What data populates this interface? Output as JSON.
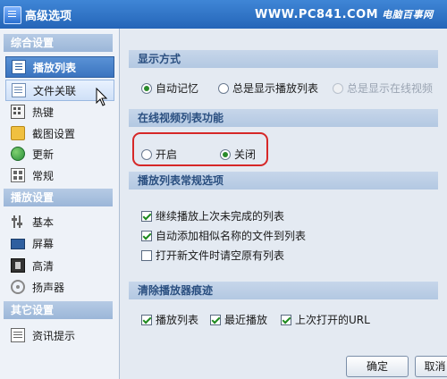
{
  "window": {
    "title": "高级选项",
    "watermark": "WWW.PC841.COM",
    "watermark_brand": "电脑百事网"
  },
  "sidebar": {
    "section1": "综合设置",
    "items1": [
      {
        "label": "播放列表",
        "icon": "list-icon"
      },
      {
        "label": "文件关联",
        "icon": "file-icon"
      },
      {
        "label": "热键",
        "icon": "keyboard-icon"
      },
      {
        "label": "截图设置",
        "icon": "folder-icon"
      },
      {
        "label": "更新",
        "icon": "globe-icon"
      },
      {
        "label": "常规",
        "icon": "grid-icon"
      }
    ],
    "section2": "播放设置",
    "items2": [
      {
        "label": "基本",
        "icon": "sliders-icon"
      },
      {
        "label": "屏幕",
        "icon": "monitor-icon"
      },
      {
        "label": "高清",
        "icon": "film-icon"
      },
      {
        "label": "扬声器",
        "icon": "speaker-icon"
      }
    ],
    "section3": "其它设置",
    "items3": [
      {
        "label": "资讯提示",
        "icon": "info-icon"
      }
    ]
  },
  "display_mode": {
    "title": "显示方式",
    "options": [
      "自动记忆",
      "总是显示播放列表",
      "总是显示在线视频"
    ]
  },
  "online_list": {
    "title": "在线视频列表功能",
    "options": [
      "开启",
      "关闭"
    ]
  },
  "list_options": {
    "title": "播放列表常规选项",
    "checks": [
      "继续播放上次未完成的列表",
      "自动添加相似名称的文件到列表",
      "打开新文件时请空原有列表"
    ]
  },
  "clear_traces": {
    "title": "清除播放器痕迹",
    "checks": [
      "播放列表",
      "最近播放",
      "上次打开的URL"
    ]
  },
  "buttons": {
    "ok": "确定",
    "cancel": "取消"
  },
  "colors": {
    "accent": "#2565b8",
    "highlight": "#d62828",
    "check": "#1e8a1e"
  }
}
